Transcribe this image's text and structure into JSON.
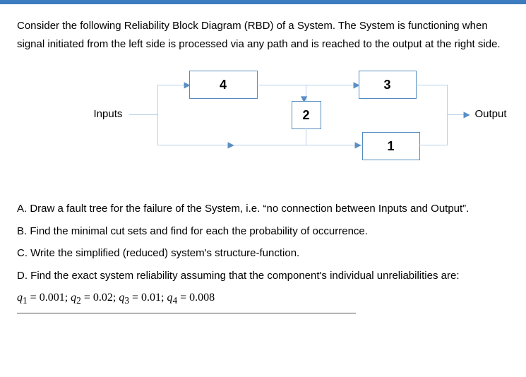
{
  "intro1": "Consider the following Reliability Block Diagram (RBD) of a System. The System is functioning when",
  "intro2": "signal initiated from the left side is processed via any path and is reached to the output at the right side.",
  "labels": {
    "inputs": "Inputs",
    "output": "Output"
  },
  "blocks": {
    "b1": "1",
    "b2": "2",
    "b3": "3",
    "b4": "4"
  },
  "questions": {
    "A": "A. Draw a fault tree for the failure of the System, i.e. “no connection between Inputs and Output”.",
    "B": "B. Find the minimal cut sets and find for each the probability of occurrence.",
    "C": "C. Write the simplified (reduced) system's structure-function.",
    "D": "D. Find the exact system reliability assuming that the component's individual unreliabilities are:"
  },
  "equation": {
    "q1": "q",
    "s1": "1",
    "v1": "0.001",
    "q2": "q",
    "s2": "2",
    "v2": "0.02",
    "q3": "q",
    "s3": "3",
    "v3": "0.01",
    "q4": "q",
    "s4": "4",
    "v4": "0.008"
  }
}
